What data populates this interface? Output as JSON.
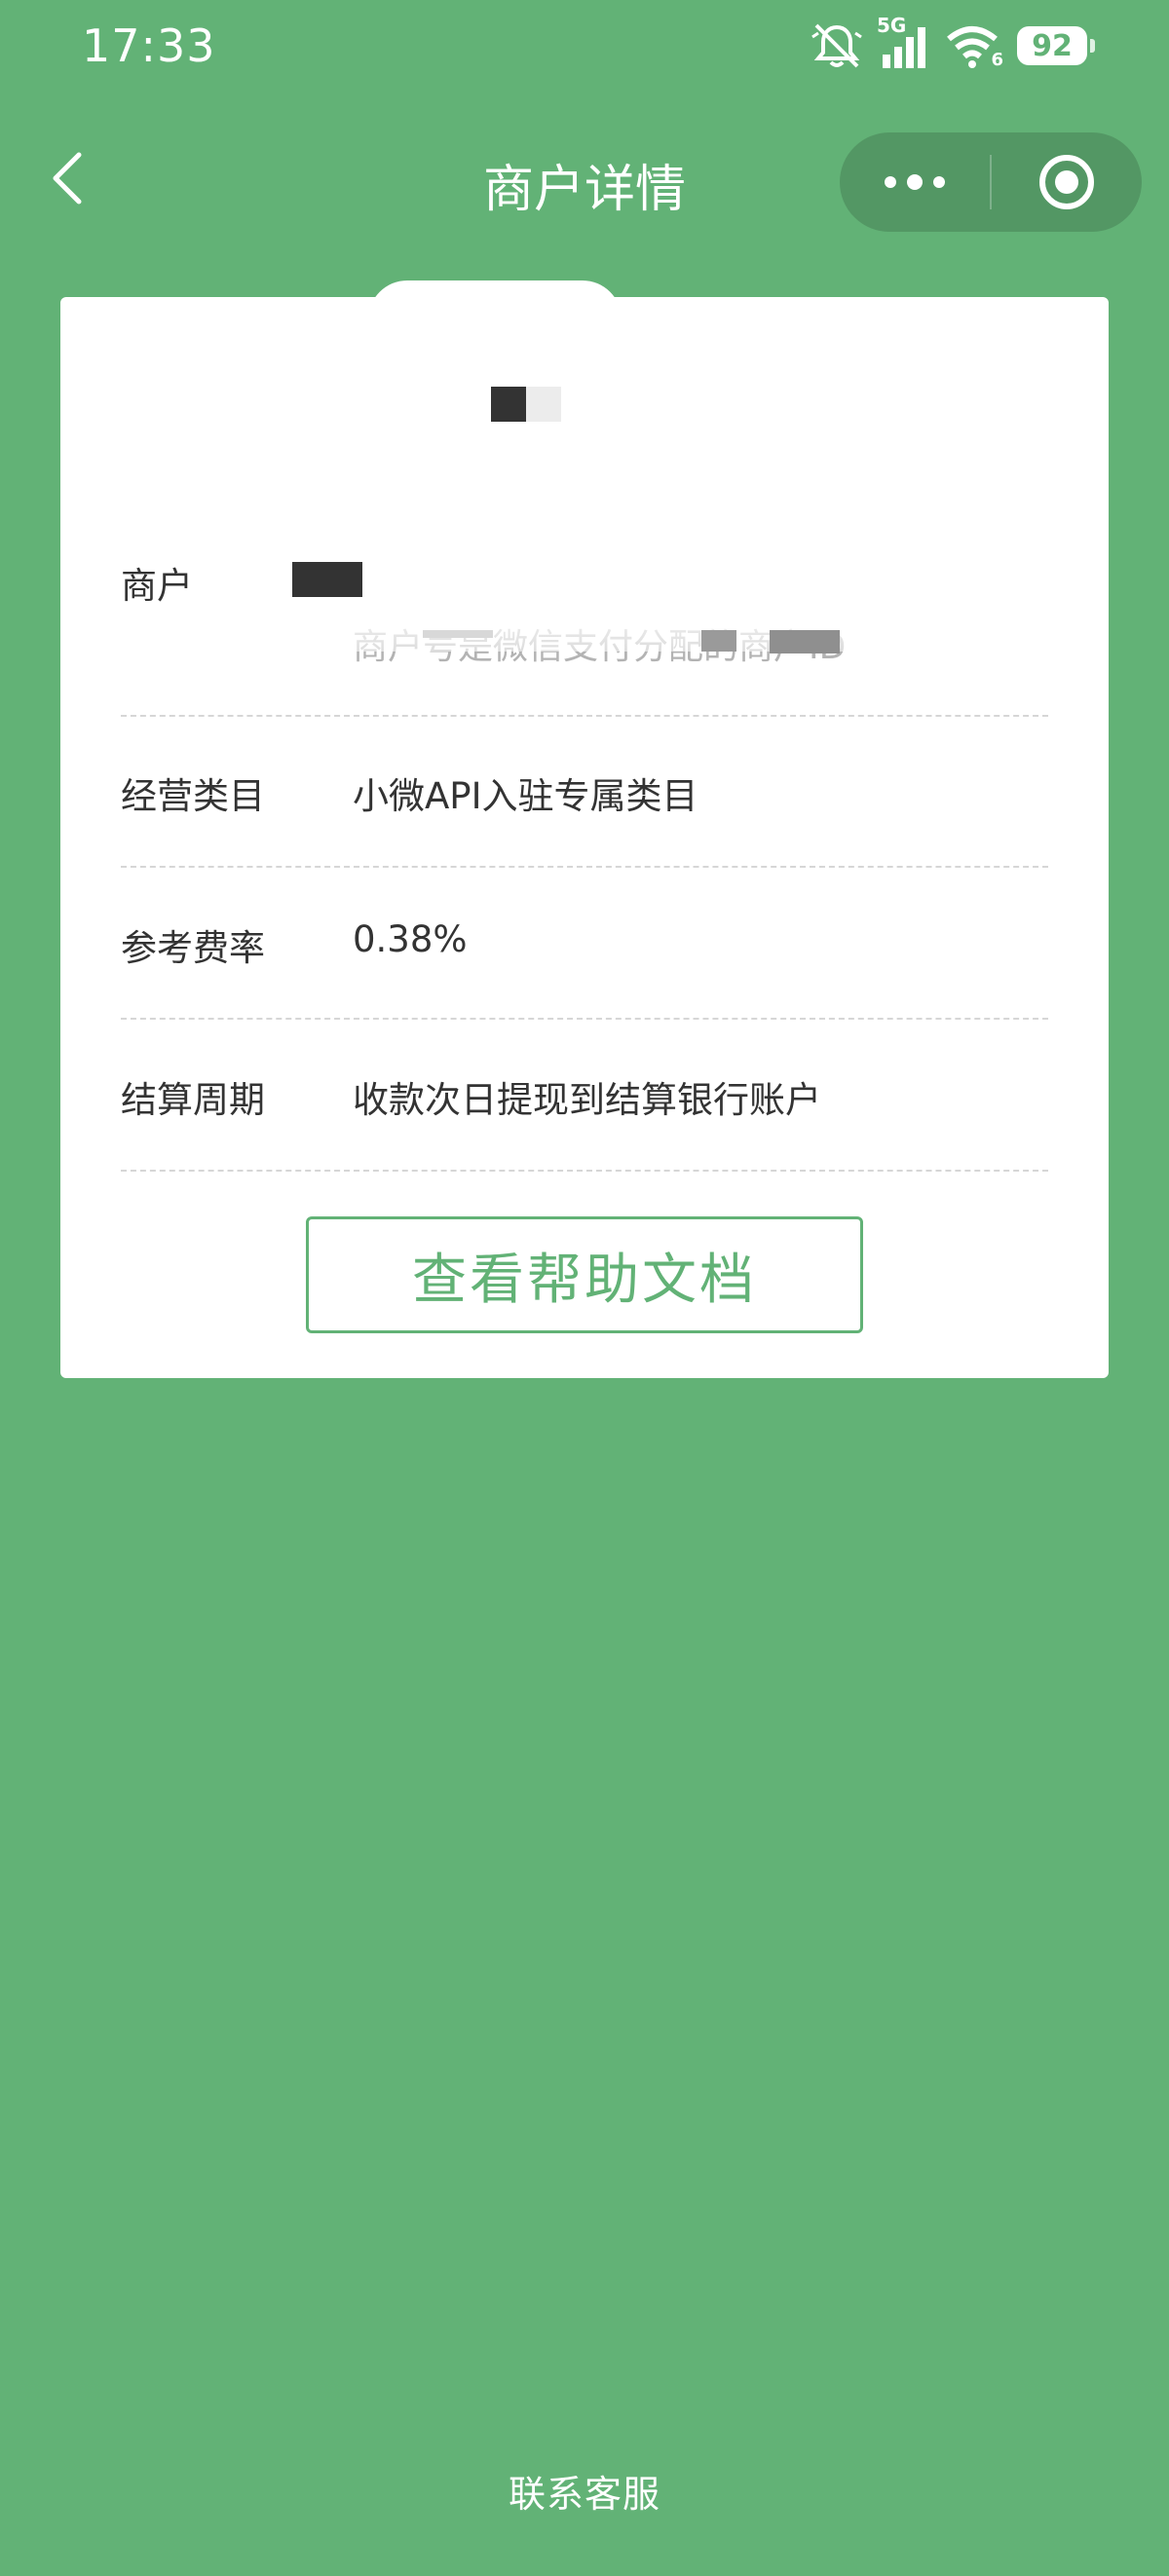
{
  "status_bar": {
    "time": "17:33",
    "network": "5G",
    "wifi_badge": "6",
    "battery_level": "92"
  },
  "nav": {
    "title": "商户详情"
  },
  "merchant": {
    "label": "商户",
    "hint": "商户号是微信支付分配的商户ID"
  },
  "details": [
    {
      "label": "经营类目",
      "value": "小微API入驻专属类目"
    },
    {
      "label": "参考费率",
      "value": "0.38%"
    },
    {
      "label": "结算周期",
      "value": "收款次日提现到结算银行账户"
    }
  ],
  "help_button_label": "查看帮助文档",
  "contact_label": "联系客服",
  "colors": {
    "background": "#62b276",
    "card": "#ffffff",
    "accent": "#62b276",
    "text": "#333333",
    "muted": "#b3b3b3"
  }
}
